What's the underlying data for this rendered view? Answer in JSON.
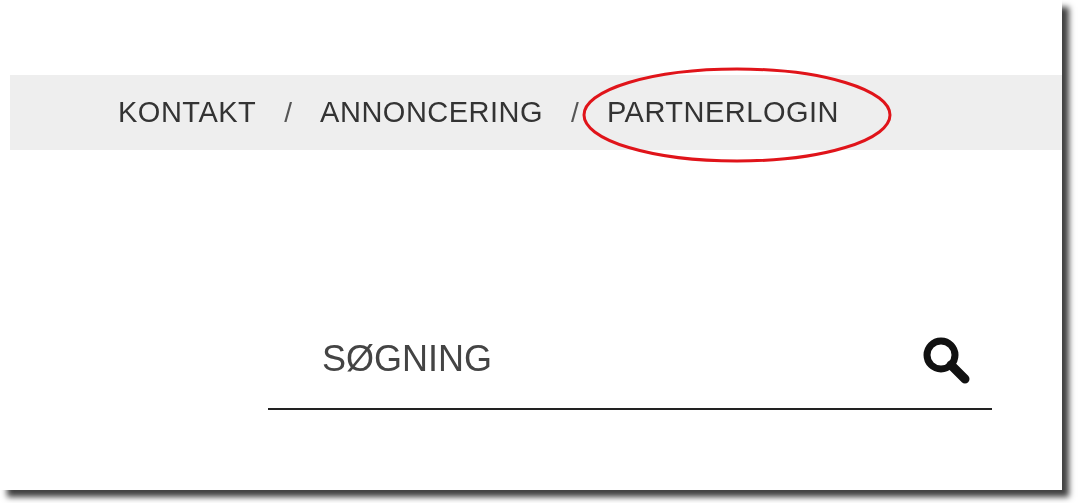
{
  "nav": {
    "items": [
      {
        "kind": "link",
        "label": "KONTAKT",
        "highlighted": false
      },
      {
        "kind": "separator",
        "label": "/"
      },
      {
        "kind": "link",
        "label": "ANNONCERING",
        "highlighted": false
      },
      {
        "kind": "separator",
        "label": "/"
      },
      {
        "kind": "link",
        "label": "PARTNERLOGIN",
        "highlighted": true
      }
    ]
  },
  "search": {
    "placeholder": "SØGNING"
  }
}
